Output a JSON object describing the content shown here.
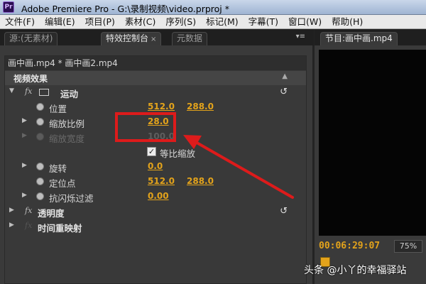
{
  "window": {
    "title": "Adobe Premiere Pro - G:\\录制视频\\video.prproj *",
    "app_icon": "Pr"
  },
  "menu": [
    "文件(F)",
    "编辑(E)",
    "项目(P)",
    "素材(C)",
    "序列(S)",
    "标记(M)",
    "字幕(T)",
    "窗口(W)",
    "帮助(H)"
  ],
  "left_panel": {
    "tabs": [
      {
        "label": "源:(无素材)",
        "active": false
      },
      {
        "label": "特效控制台",
        "active": true,
        "close": "×"
      },
      {
        "label": "元数据",
        "active": false
      }
    ],
    "menu_icon": "▾≡"
  },
  "effect_controls": {
    "clip_header": "画中画.mp4 * 画中画2.mp4",
    "section_title": "视频效果",
    "motion": {
      "label": "运动",
      "params": [
        {
          "label": "位置",
          "value1": "512.0",
          "value2": "288.0",
          "expandable": false,
          "dim": false
        },
        {
          "label": "缩放比例",
          "value1": "28.0",
          "value2": "",
          "expandable": true,
          "dim": false
        },
        {
          "label": "缩放宽度",
          "value1": "100.0",
          "value2": "",
          "expandable": true,
          "dim": true
        },
        {
          "label": "旋转",
          "value1": "0.0",
          "value2": "",
          "expandable": true,
          "dim": false
        },
        {
          "label": "定位点",
          "value1": "512.0",
          "value2": "288.0",
          "expandable": false,
          "dim": false
        },
        {
          "label": "抗闪烁过滤",
          "value1": "0.00",
          "value2": "",
          "expandable": true,
          "dim": false
        }
      ],
      "uniform_scale_label": "等比缩放",
      "uniform_scale_checked": true
    },
    "opacity_label": "透明度",
    "time_remap_label": "时间重映射",
    "fx_label": "fx"
  },
  "program_monitor": {
    "tab_label": "节目:画中画.mp4",
    "timecode": "00:06:29:07",
    "zoom": "75%"
  },
  "watermark": "头条 @小丫的幸福驿站",
  "colors": {
    "accent_value": "#e3a31b",
    "highlight": "#dd1b1b"
  }
}
